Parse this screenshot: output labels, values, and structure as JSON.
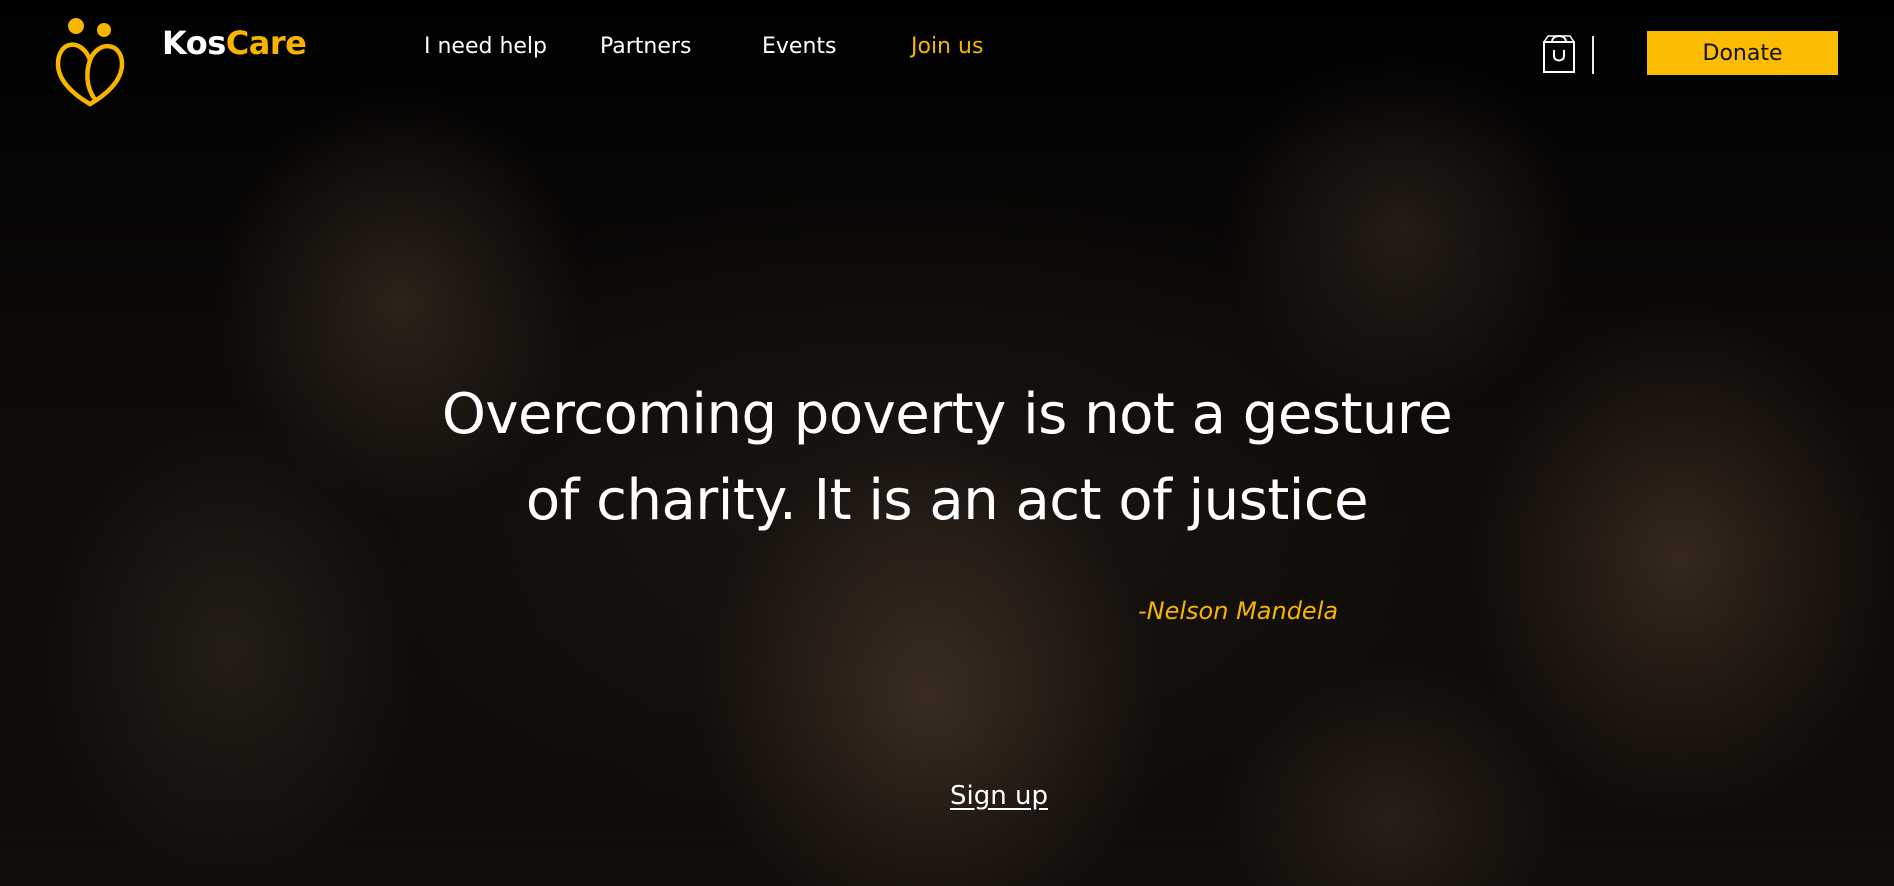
{
  "brand": {
    "name_part1": "Kos",
    "name_part2": "Care",
    "accent_color": "#f7b500"
  },
  "nav": {
    "items": [
      {
        "label": "I need help",
        "active": false
      },
      {
        "label": "Partners",
        "active": false
      },
      {
        "label": "Events",
        "active": false
      },
      {
        "label": "Join us",
        "active": true
      }
    ]
  },
  "header_actions": {
    "cart_icon": "shopping-bag-icon",
    "donate_label": "Donate",
    "donate_color": "#fbbb00"
  },
  "hero": {
    "quote_line1": "Overcoming poverty is not a gesture",
    "quote_line2": "of charity. It is an act of justice",
    "author": "-Nelson Mandela",
    "signup_label": "Sign up"
  }
}
